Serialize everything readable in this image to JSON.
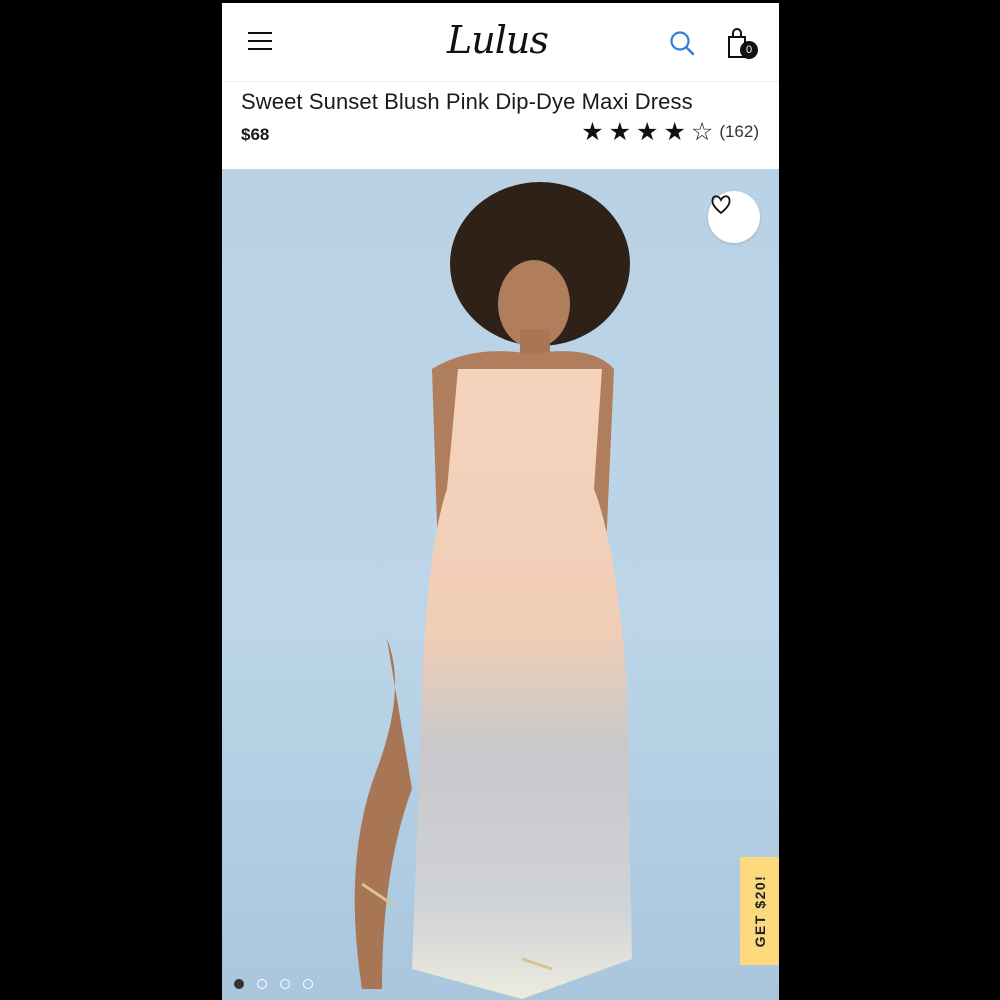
{
  "header": {
    "logo": "Lulus",
    "cart_count": "0"
  },
  "product": {
    "title": "Sweet Sunset Blush Pink Dip-Dye Maxi Dress",
    "price": "$68",
    "rating": 4,
    "rating_max": 5,
    "review_count": "(162)"
  },
  "gallery": {
    "image_count": 4,
    "active_index": 0
  },
  "promo": {
    "label": "GET $20!"
  },
  "colors": {
    "background_blue": "#b9d2e5",
    "promo_yellow": "#fdd97d",
    "search_blue": "#2a7fd6"
  },
  "icons": [
    "menu-icon",
    "search-icon",
    "shopping-bag-icon",
    "heart-icon",
    "star-icon"
  ]
}
